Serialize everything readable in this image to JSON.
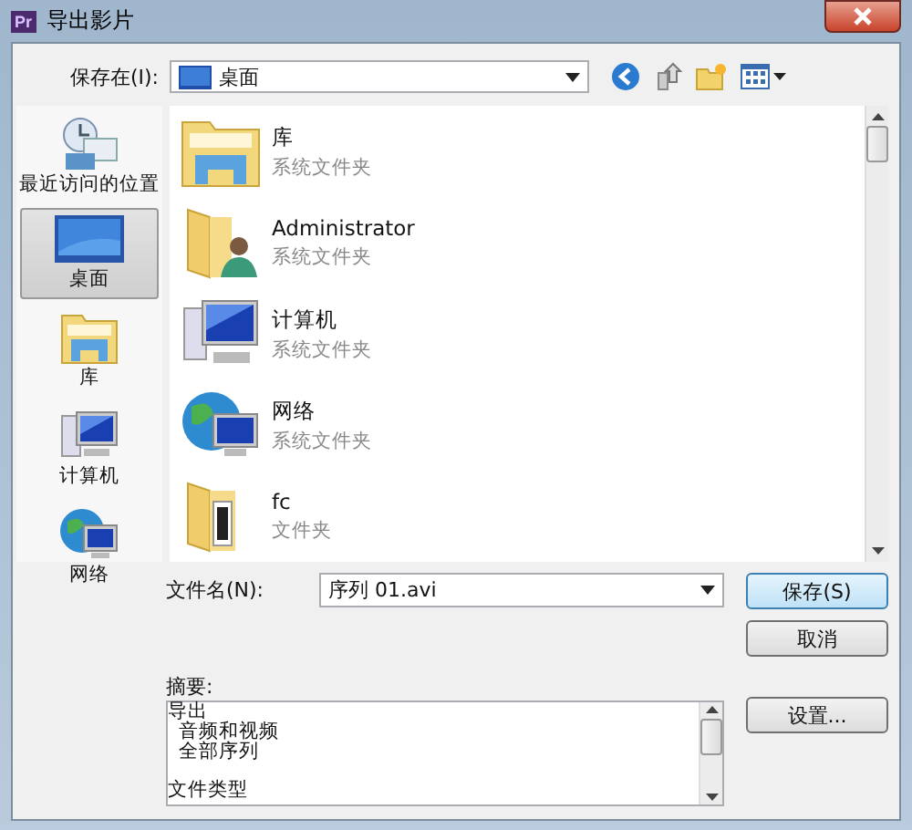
{
  "window": {
    "badge": "Pr",
    "title": "导出影片"
  },
  "save_in": {
    "label": "保存在(I):",
    "value": "桌面"
  },
  "places": [
    {
      "kind": "recent",
      "label": "最近访问的位置",
      "selected": false
    },
    {
      "kind": "desktop",
      "label": "桌面",
      "selected": true
    },
    {
      "kind": "library",
      "label": "库",
      "selected": false
    },
    {
      "kind": "computer",
      "label": "计算机",
      "selected": false
    },
    {
      "kind": "network",
      "label": "网络",
      "selected": false
    }
  ],
  "files": [
    {
      "kind": "library",
      "name": "库",
      "type": "系统文件夹"
    },
    {
      "kind": "user",
      "name": "Administrator",
      "type": "系统文件夹"
    },
    {
      "kind": "computer",
      "name": "计算机",
      "type": "系统文件夹"
    },
    {
      "kind": "network",
      "name": "网络",
      "type": "系统文件夹"
    },
    {
      "kind": "folder",
      "name": "fc",
      "type": "文件夹"
    }
  ],
  "filename": {
    "label": "文件名(N):",
    "value": "序列 01.avi"
  },
  "buttons": {
    "save": "保存(S)",
    "cancel": "取消",
    "settings": "设置..."
  },
  "summary": {
    "label": "摘要:",
    "sections": [
      {
        "heading": "导出",
        "items": [
          "音频和视频",
          "全部序列"
        ]
      },
      {
        "heading": "文件类型"
      }
    ]
  }
}
